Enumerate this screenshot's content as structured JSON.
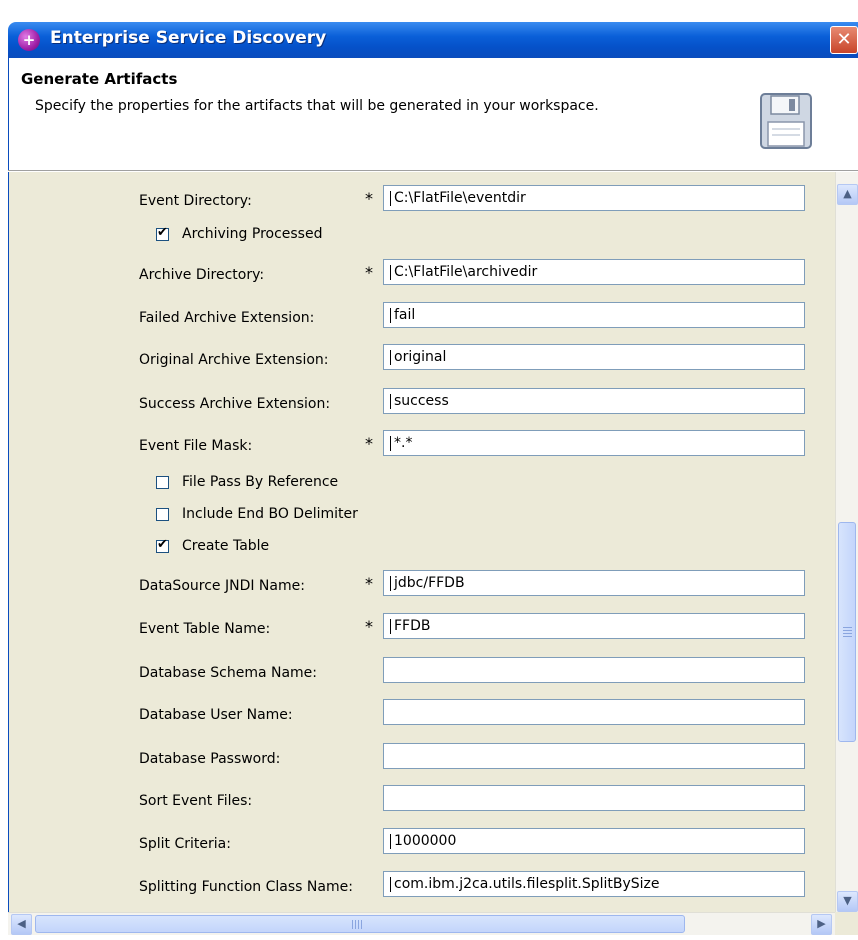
{
  "window": {
    "title": "Enterprise Service Discovery",
    "close_icon": "close-icon"
  },
  "header": {
    "title": "Generate Artifacts",
    "description": "Specify the properties for the artifacts that will be generated in your workspace."
  },
  "form": {
    "event_directory": {
      "label": "Event Directory:",
      "required": "*",
      "value": "C:\\FlatFile\\eventdir"
    },
    "archiving_processed": {
      "label": "Archiving Processed",
      "checked": "✔"
    },
    "archive_directory": {
      "label": "Archive Directory:",
      "required": "*",
      "value": "C:\\FlatFile\\archivedir"
    },
    "failed_archive_extension": {
      "label": "Failed Archive Extension:",
      "value": "fail"
    },
    "original_archive_extension": {
      "label": "Original Archive Extension:",
      "value": "original"
    },
    "success_archive_extension": {
      "label": "Success Archive Extension:",
      "value": "success"
    },
    "event_file_mask": {
      "label": "Event File Mask:",
      "required": "*",
      "value": "*.*"
    },
    "file_pass_by_reference": {
      "label": "File Pass By Reference",
      "checked": ""
    },
    "include_end_bo_delimiter": {
      "label": "Include End BO Delimiter",
      "checked": ""
    },
    "create_table": {
      "label": "Create Table",
      "checked": "✔"
    },
    "datasource_jndi_name": {
      "label": "DataSource JNDI Name:",
      "required": "*",
      "value": "jdbc/FFDB"
    },
    "event_table_name": {
      "label": "Event Table Name:",
      "required": "*",
      "value": "FFDB"
    },
    "database_schema_name": {
      "label": "Database Schema Name:",
      "value": ""
    },
    "database_user_name": {
      "label": "Database User Name:",
      "value": ""
    },
    "database_password": {
      "label": "Database Password:",
      "value": ""
    },
    "sort_event_files": {
      "label": "Sort Event Files:",
      "value": ""
    },
    "split_criteria": {
      "label": "Split Criteria:",
      "value": "1000000"
    },
    "splitting_function_class_name": {
      "label": "Splitting Function Class Name:",
      "value": "com.ibm.j2ca.utils.filesplit.SplitBySize"
    }
  },
  "scrollbars": {
    "up": "▲",
    "down": "▼",
    "left": "◀",
    "right": "▶"
  }
}
